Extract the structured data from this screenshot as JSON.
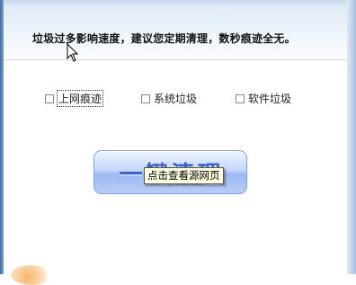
{
  "notice": {
    "text": "垃圾过多影响速度，建议您定期清理，数秒痕迹全无。"
  },
  "options": [
    {
      "label": "上网痕迹",
      "checked": false
    },
    {
      "label": "系统垃圾",
      "checked": false
    },
    {
      "label": "软件垃圾",
      "checked": false
    }
  ],
  "clean_button": {
    "label": "一键清理"
  },
  "tooltip": {
    "text": "点击查看源网页"
  }
}
